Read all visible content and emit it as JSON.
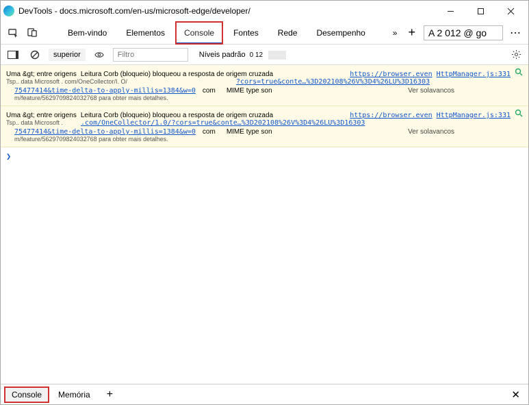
{
  "window": {
    "title": "DevTools - docs.microsoft.com/en-us/microsoft-edge/developer/"
  },
  "tabs": {
    "welcome": "Bem-vindo",
    "elements": "Elementos",
    "console": "Console",
    "sources": "Fontes",
    "network": "Rede",
    "performance": "Desempenho",
    "more_glyph": "»",
    "plus_glyph": "+",
    "zoom_text": "A 2 012 @ go",
    "kebab_glyph": "⋯"
  },
  "toolbar": {
    "context": "superior",
    "filter_placeholder": "Filtro",
    "levels_label": "Níveis padrão",
    "hidden_count": "0 12"
  },
  "messages": [
    {
      "label": "Uma &gt; entre origens",
      "sub": "Tsp.. data Microsoft . com/OneCollector/I. O/",
      "text": "Leitura Corb (bloqueio) bloqueou a resposta de origem cruzada",
      "link1": "https://browser.even",
      "link2": "?cors=true&conte…%3D202108%26V%3D4%26LU%3D16303",
      "link3": "75477414&time-delta-to-apply-millis=1384&w=0",
      "com": "com",
      "mime": "MIME type son",
      "bumps": "Ver solavancos",
      "src": "HttpManager.js:331",
      "more": "m/feature/5629709824032768 para obter mais detalhes."
    },
    {
      "label": "Uma &gt; entre origens",
      "sub": "Tsp.. data Microsoft .",
      "text": "Leitura Corb (bloqueio) bloqueou a resposta de origem cruzada",
      "link1": "https://browser.even",
      "link2": ".com/OneCollector/1.0/?cors=true&conte…%3D202108%26V%3D4%26LU%3D16303",
      "link3": "75477414&time-delta-to-apply-millis=1384&w=0",
      "com": "com",
      "mime": "MIME type son",
      "bumps": "Ver solavancos",
      "src": "HttpManager.js:331",
      "more": "m/feature/5629709824032768 para obter mais detalhes."
    }
  ],
  "prompt_glyph": "❯",
  "drawer": {
    "console": "Console",
    "memory": "Memória",
    "plus_glyph": "+",
    "close_glyph": "✕"
  }
}
